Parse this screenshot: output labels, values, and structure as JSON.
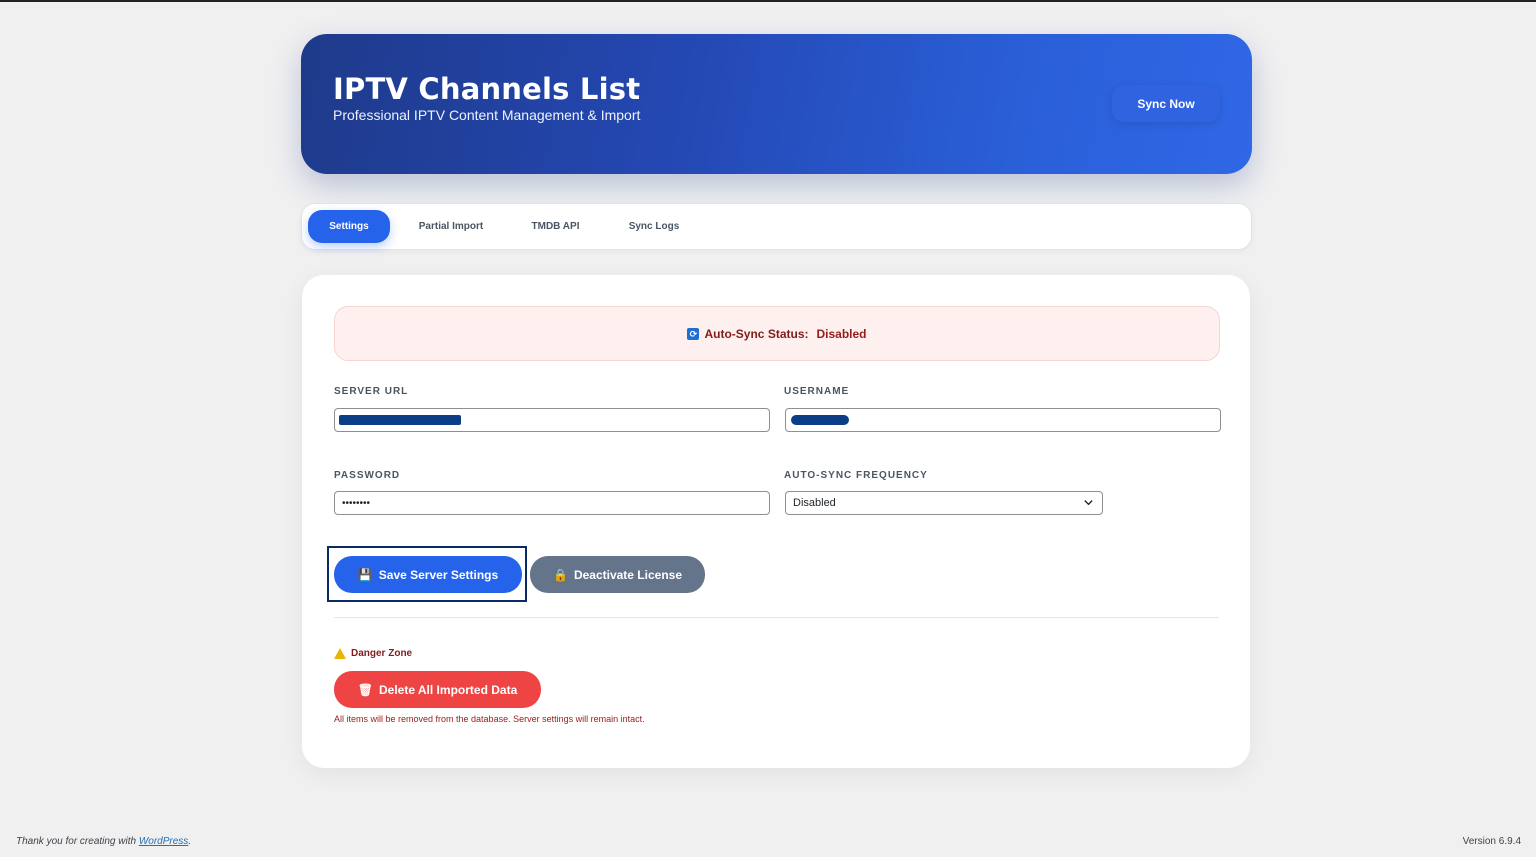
{
  "header": {
    "title": "IPTV Channels List",
    "subtitle": "Professional IPTV Content Management & Import",
    "sync_button": "Sync Now"
  },
  "tabs": [
    {
      "label": "Settings",
      "active": true
    },
    {
      "label": "Partial Import",
      "active": false
    },
    {
      "label": "TMDB API",
      "active": false
    },
    {
      "label": "Sync Logs",
      "active": false
    }
  ],
  "status": {
    "label": "Auto-Sync Status:",
    "value": "Disabled",
    "icon": "sync-icon"
  },
  "form": {
    "server_url_label": "SERVER URL",
    "username_label": "USERNAME",
    "password_label": "PASSWORD",
    "password_value": "••••••••",
    "frequency_label": "AUTO-SYNC FREQUENCY",
    "frequency_value": "Disabled"
  },
  "buttons": {
    "save": "Save Server Settings",
    "deactivate": "Deactivate License",
    "delete": "Delete All Imported Data"
  },
  "danger": {
    "title": "Danger Zone",
    "note": "All items will be removed from the database. Server settings will remain intact."
  },
  "footer": {
    "thanks": "Thank you for creating with",
    "link": "WordPress",
    "version": "Version 6.9.4"
  },
  "colors": {
    "primary": "#2563eb",
    "danger": "#ef4444",
    "secondary": "#64748b",
    "header_start": "#1e3a8a",
    "header_end": "#2f67e6"
  }
}
